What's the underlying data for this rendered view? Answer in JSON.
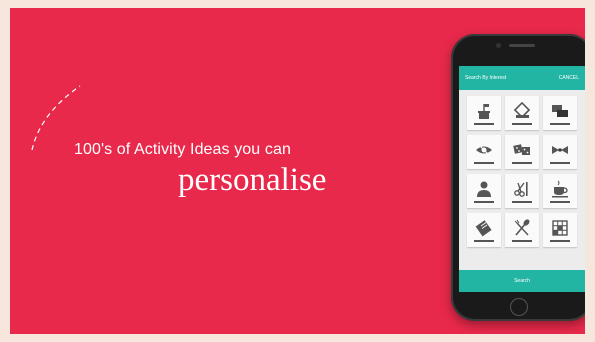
{
  "banner": {
    "tagline": "100's of Activity Ideas you can",
    "headline": "personalise"
  },
  "phone": {
    "header": {
      "title": "Search By Interest",
      "action": "CANCEL"
    },
    "tiles": [
      {
        "icon": "plant-icon"
      },
      {
        "icon": "paint-bucket-icon"
      },
      {
        "icon": "chat-bubbles-icon"
      },
      {
        "icon": "eye-icon"
      },
      {
        "icon": "dice-icon"
      },
      {
        "icon": "bow-tie-icon"
      },
      {
        "icon": "person-icon"
      },
      {
        "icon": "scissors-icon"
      },
      {
        "icon": "coffee-cup-icon"
      },
      {
        "icon": "book-icon"
      },
      {
        "icon": "cutlery-icon"
      },
      {
        "icon": "crossword-icon"
      }
    ],
    "search_label": "Search"
  },
  "colors": {
    "banner_bg": "#e8294b",
    "page_bg": "#f6e6dc",
    "app_accent": "#23b5a4"
  }
}
